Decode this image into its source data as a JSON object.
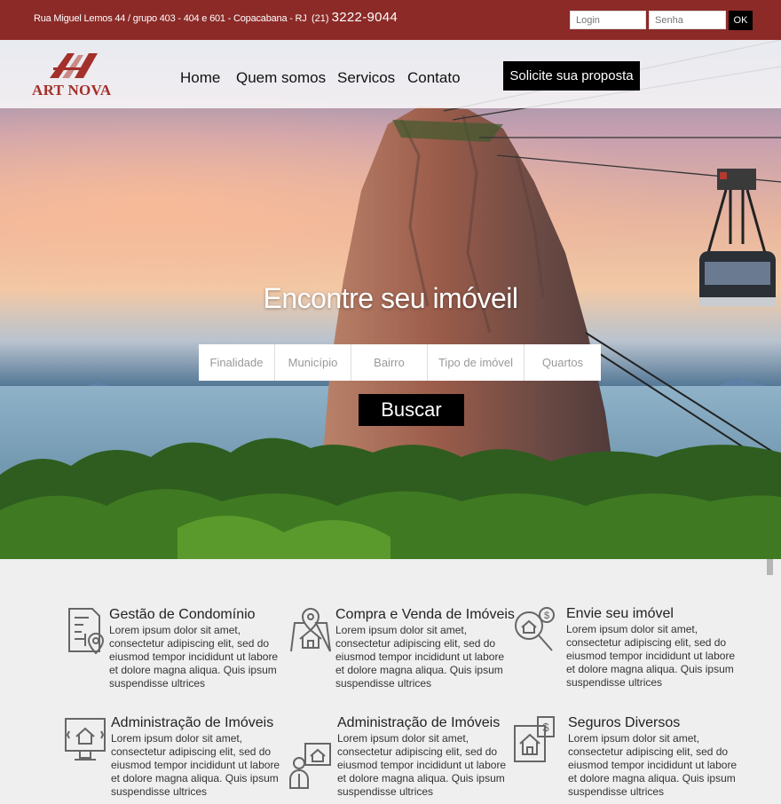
{
  "topbar": {
    "address": "Rua Miguel Lemos 44 / grupo 403 - 404 e 601 - Copacabana - RJ",
    "phone_prefix": "(21)",
    "phone_number": "3222-9044",
    "login_placeholder": "Login",
    "senha_placeholder": "Senha",
    "ok_label": "OK"
  },
  "logo": {
    "text": "ART NOVA"
  },
  "nav": {
    "items": [
      "Home",
      "Quem somos",
      "Servicos",
      "Contato"
    ]
  },
  "cta_label": "Solicite sua proposta",
  "search": {
    "headline": "Encontre seu imóveil",
    "filters": [
      "Finalidade",
      "Município",
      "Bairro",
      "Tipo de imóvel",
      "Quartos"
    ],
    "button_label": "Buscar"
  },
  "services": [
    {
      "title": "Gestão de Condomínio",
      "icon": "document-map-pin-icon",
      "description": "Lorem ipsum dolor sit amet, consectetur adipiscing elit, sed do eiusmod tempor incididunt ut labore et dolore magna aliqua. Quis ipsum suspendisse ultrices"
    },
    {
      "title": "Compra e Venda de Imóveis",
      "icon": "house-location-icon",
      "description": "Lorem ipsum dolor sit amet, consectetur adipiscing elit, sed do eiusmod tempor incididunt ut labore et dolore magna aliqua. Quis ipsum suspendisse ultrices"
    },
    {
      "title": "Envie seu imóvel",
      "icon": "house-search-dollar-icon",
      "description": "Lorem ipsum dolor sit amet, consectetur adipiscing elit, sed do eiusmod tempor incididunt ut labore et dolore magna aliqua. Quis ipsum suspendisse ultrices"
    },
    {
      "title": "Administração de Imóveis",
      "icon": "monitor-house-icon",
      "description": "Lorem ipsum dolor sit amet, consectetur adipiscing elit, sed do eiusmod tempor incididunt ut labore et dolore magna aliqua. Quis ipsum suspendisse ultrices"
    },
    {
      "title": "Administração de Imóveis",
      "icon": "people-house-icon",
      "description": "Lorem ipsum dolor sit amet, consectetur adipiscing elit, sed do eiusmod tempor incididunt ut labore et dolore magna aliqua. Quis ipsum suspendisse ultrices"
    },
    {
      "title": "Seguros Diversos",
      "icon": "house-insurance-dollar-icon",
      "description": "Lorem ipsum dolor sit amet, consectetur adipiscing elit, sed do eiusmod tempor incididunt ut labore et dolore magna aliqua. Quis ipsum suspendisse ultrices"
    }
  ],
  "colors": {
    "brand": "#8b2a27",
    "logo": "#a3302a",
    "button": "#000000",
    "section_bg": "#efefef"
  }
}
